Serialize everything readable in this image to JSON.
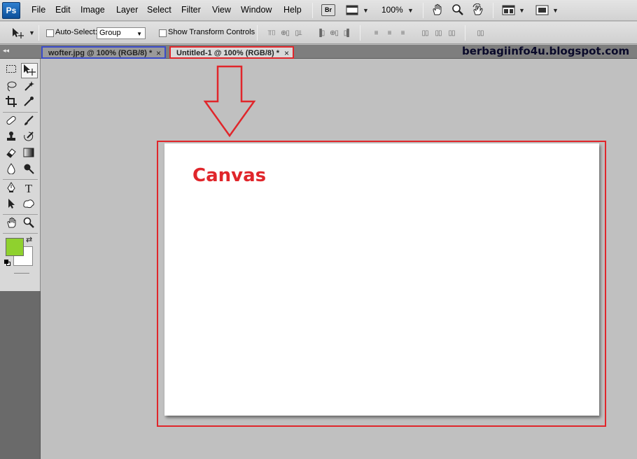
{
  "app": {
    "logo": "Ps"
  },
  "menu": [
    "File",
    "Edit",
    "Image",
    "Layer",
    "Select",
    "Filter",
    "View",
    "Window",
    "Help"
  ],
  "appbar": {
    "bridge_label": "Br",
    "zoom": "100%"
  },
  "options": {
    "auto_select_label": "Auto-Select:",
    "auto_select_value": "Group",
    "transform_label": "Show Transform Controls"
  },
  "tabs": [
    {
      "label": "wofter.jpg @ 100% (RGB/8) *",
      "close": "×",
      "highlight": "#3a4bc8"
    },
    {
      "label": "Untitled-1 @ 100% (RGB/8) *",
      "close": "×",
      "highlight": "#e0262b"
    }
  ],
  "watermark": "berbagiinfo4u.blogspot.com",
  "annotation": {
    "label": "Canvas",
    "color": "#e0262b"
  },
  "colors": {
    "foreground": "#8fd12e",
    "background": "#ffffff",
    "annotation_red": "#e0262b",
    "annotation_blue": "#3a4bc8"
  }
}
